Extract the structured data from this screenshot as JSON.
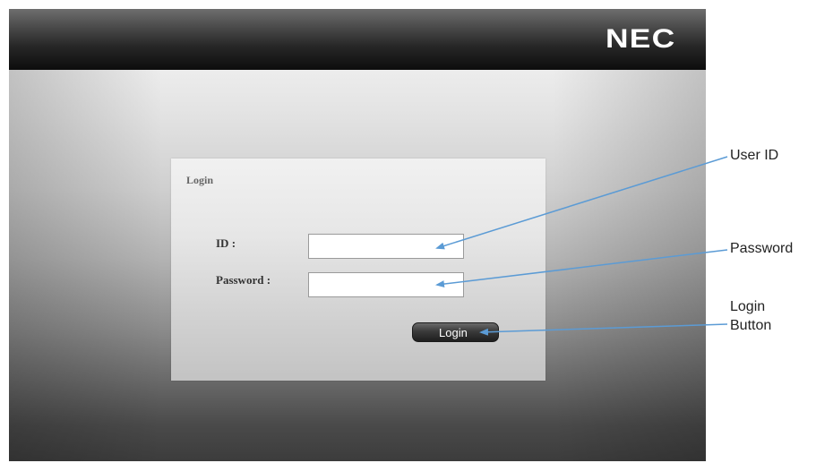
{
  "header": {
    "logo_text": "NEC",
    "background": "#111111"
  },
  "login_panel": {
    "title": "Login",
    "id_label": "ID :",
    "id_value": "",
    "password_label": "Password :",
    "password_value": "",
    "login_button_label": "Login"
  },
  "annotations": {
    "user_id": "User ID",
    "password": "Password",
    "login_button": "Login Button",
    "arrow_color": "#5b9bd5"
  }
}
